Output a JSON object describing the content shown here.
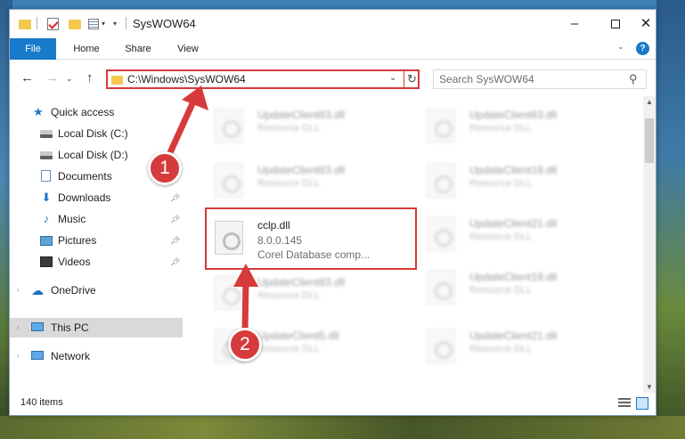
{
  "window": {
    "title": "SysWOW64",
    "controls": {
      "minimize": "–",
      "close": "✕"
    }
  },
  "ribbon": {
    "tabs": [
      {
        "label": "File"
      },
      {
        "label": "Home"
      },
      {
        "label": "Share"
      },
      {
        "label": "View"
      }
    ],
    "help": "?"
  },
  "navigation": {
    "address": "C:\\Windows\\SysWOW64",
    "search_placeholder": "Search SysWOW64"
  },
  "sidebar": {
    "items": [
      {
        "label": "Quick access",
        "icon": "star-icon"
      },
      {
        "label": "Local Disk (C:)",
        "icon": "disk-icon"
      },
      {
        "label": "Local Disk (D:)",
        "icon": "disk-icon"
      },
      {
        "label": "Documents",
        "icon": "documents-icon",
        "pinned": true
      },
      {
        "label": "Downloads",
        "icon": "downloads-icon",
        "pinned": true
      },
      {
        "label": "Music",
        "icon": "music-icon",
        "pinned": true
      },
      {
        "label": "Pictures",
        "icon": "pictures-icon",
        "pinned": true
      },
      {
        "label": "Videos",
        "icon": "videos-icon",
        "pinned": true
      },
      {
        "label": "OneDrive",
        "icon": "onedrive-icon"
      },
      {
        "label": "This PC",
        "icon": "computer-icon",
        "selected": true
      },
      {
        "label": "Network",
        "icon": "network-icon"
      }
    ]
  },
  "files": {
    "background_tiles": [
      {
        "name": "UpdateClient63.dll",
        "desc": "Resource DLL"
      },
      {
        "name": "UpdateClient63.dll",
        "desc": "Resource DLL"
      },
      {
        "name": "UpdateClient63.dll",
        "desc": "Resource DLL"
      },
      {
        "name": "UpdateClient19.dll",
        "desc": "Resource DLL"
      },
      {
        "name": "UpdateClient21.dll",
        "desc": "Resource DLL"
      },
      {
        "name": "UpdateClient63.dll",
        "desc": "Resource DLL"
      },
      {
        "name": "UpdateClient19.dll",
        "desc": "Resource DLL"
      },
      {
        "name": "UpdateClient5.dll",
        "desc": "Resource DLL"
      },
      {
        "name": "UpdateClient21.dll",
        "desc": "Resource DLL"
      }
    ],
    "highlighted": {
      "name": "cclp.dll",
      "version": "8.0.0.145",
      "description": "Corel Database comp..."
    }
  },
  "status": {
    "item_count": "140 items"
  },
  "annotations": {
    "step1": "1",
    "step2": "2"
  },
  "colors": {
    "accent": "#1979ca",
    "annotation": "#d23a3a"
  }
}
